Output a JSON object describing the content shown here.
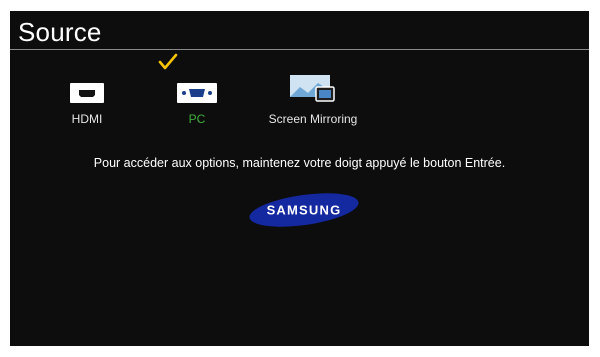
{
  "header": {
    "title": "Source"
  },
  "sources": [
    {
      "label": "HDMI",
      "icon": "hdmi-port-icon",
      "selected": false
    },
    {
      "label": "PC",
      "icon": "vga-port-icon",
      "selected": true
    },
    {
      "label": "Screen Mirroring",
      "icon": "screen-mirroring-icon",
      "selected": false
    }
  ],
  "hint": "Pour accéder aux options, maintenez votre doigt appuyé le bouton Entrée.",
  "brand": {
    "logo_text": "SAMSUNG",
    "logo_color": "#1428a0"
  },
  "colors": {
    "background": "#0d0d0d",
    "selected_label": "#3fae3f",
    "check": "#f5c400"
  }
}
